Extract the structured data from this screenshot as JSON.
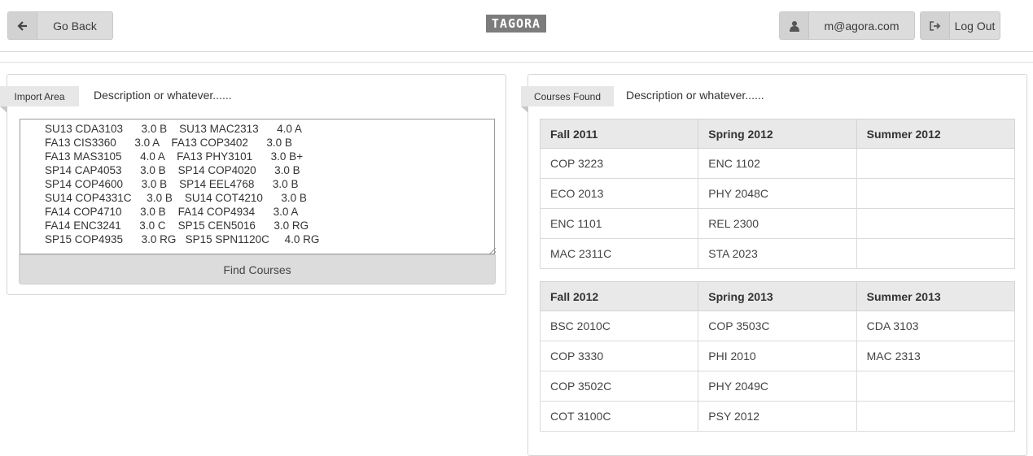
{
  "header": {
    "back_label": "Go Back",
    "logo_text": "TAGORA",
    "user_email": "m@agora.com",
    "logout_label": "Log Out"
  },
  "import_panel": {
    "ribbon": "Import Area",
    "description": "Description or whatever......",
    "text_value": "SU13 CDA3103      3.0 B    SU13 MAC2313      4.0 A\nFA13 CIS3360      3.0 A    FA13 COP3402      3.0 B\nFA13 MAS3105      4.0 A    FA13 PHY3101      3.0 B+\nSP14 CAP4053      3.0 B    SP14 COP4020      3.0 B\nSP14 COP4600      3.0 B    SP14 EEL4768      3.0 B\nSU14 COP4331C     3.0 B    SU14 COT4210      3.0 B\nFA14 COP4710      3.0 B    FA14 COP4934      3.0 A\nFA14 ENC3241      3.0 C    SP15 CEN5016      3.0 RG\nSP15 COP4935      3.0 RG   SP15 SPN1120C     4.0 RG",
    "find_button": "Find Courses"
  },
  "courses_panel": {
    "ribbon": "Courses Found",
    "description": "Description or whatever......",
    "tables": [
      {
        "headers": [
          "Fall 2011",
          "Spring 2012",
          "Summer 2012"
        ],
        "rows": [
          [
            "COP 3223",
            "ENC 1102",
            ""
          ],
          [
            "ECO 2013",
            "PHY 2048C",
            ""
          ],
          [
            "ENC 1101",
            "REL 2300",
            ""
          ],
          [
            "MAC 2311C",
            "STA 2023",
            ""
          ]
        ]
      },
      {
        "headers": [
          "Fall 2012",
          "Spring 2013",
          "Summer 2013"
        ],
        "rows": [
          [
            "BSC 2010C",
            "COP 3503C",
            "CDA 3103"
          ],
          [
            "COP 3330",
            "PHI 2010",
            "MAC 2313"
          ],
          [
            "COP 3502C",
            "PHY 2049C",
            ""
          ],
          [
            "COT 3100C",
            "PSY 2012",
            ""
          ]
        ]
      }
    ]
  },
  "icons": {
    "back": "arrow-left-icon",
    "user": "user-icon",
    "logout": "sign-out-icon"
  }
}
